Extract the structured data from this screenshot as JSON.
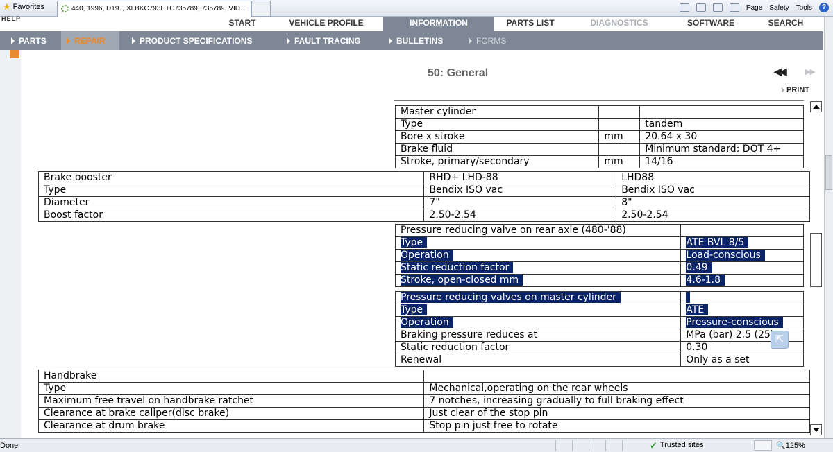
{
  "browser": {
    "favorites": "Favorites",
    "tab_title": "440, 1996, D19T, XLBKC793ETC735789, 735789, VID...",
    "tools": {
      "page": "Page",
      "safety": "Safety",
      "tools": "Tools"
    },
    "status_done": "Done",
    "trusted": "Trusted sites",
    "zoom": "125%"
  },
  "app": {
    "logo_fragment": "HELP",
    "nav_primary": [
      {
        "label": "START",
        "state": "normal"
      },
      {
        "label": "VEHICLE PROFILE",
        "state": "normal"
      },
      {
        "label": "INFORMATION",
        "state": "active"
      },
      {
        "label": "PARTS LIST",
        "state": "normal"
      },
      {
        "label": "DIAGNOSTICS",
        "state": "disabled"
      },
      {
        "label": "SOFTWARE",
        "state": "normal"
      },
      {
        "label": "SEARCH",
        "state": "normal"
      }
    ],
    "nav_secondary": [
      {
        "label": "PARTS",
        "state": "normal"
      },
      {
        "label": "REPAIR",
        "state": "active"
      },
      {
        "label": "PRODUCT SPECIFICATIONS",
        "state": "normal"
      },
      {
        "label": "FAULT TRACING",
        "state": "normal"
      },
      {
        "label": "BULLETINS",
        "state": "normal"
      },
      {
        "label": "FORMS",
        "state": "dim"
      }
    ],
    "accent": "#e88a2e",
    "nav_bg": "#7d8795",
    "highlight": "#0a246a"
  },
  "page": {
    "title": "50: General",
    "print": "PRINT",
    "nav_first": "◀◀",
    "nav_prev": "▶▶"
  },
  "master_cylinder": {
    "rows": [
      [
        "Master cylinder",
        "",
        ""
      ],
      [
        "Type",
        "",
        "tandem"
      ],
      [
        "Bore x stroke",
        "mm",
        "20.64 x 30"
      ],
      [
        "Brake fluid",
        "",
        "Minimum standard: DOT 4+"
      ],
      [
        "Stroke, primary/secondary",
        "mm",
        "14/16"
      ]
    ]
  },
  "brake_booster": {
    "rows": [
      [
        "Brake booster",
        "RHD+ LHD-88",
        "LHD88"
      ],
      [
        "Type",
        "Bendix ISO vac",
        "Bendix ISO vac"
      ],
      [
        "Diameter",
        "7\"",
        "8\""
      ],
      [
        "Boost factor",
        "2.50-2.54",
        "2.50-2.54"
      ]
    ]
  },
  "prv_rear_axle": {
    "rows": [
      [
        "Pressure reducing valve on rear axle (480-'88)",
        ""
      ],
      [
        "Type",
        "ATE BVL 8/5"
      ],
      [
        "Operation",
        "Load-conscious"
      ],
      [
        "Static reduction factor",
        "0.49"
      ],
      [
        "Stroke, open-closed mm",
        "4.6-1.8"
      ]
    ]
  },
  "prv_master_cylinder": {
    "rows": [
      [
        "Pressure reducing valves on master cylinder",
        ""
      ],
      [
        "Type",
        "ATE"
      ],
      [
        "Operation",
        "Pressure-conscious"
      ],
      [
        "Braking pressure reduces at",
        "MPa (bar) 2.5 (25)"
      ],
      [
        "Static reduction factor",
        "0.30"
      ],
      [
        "Renewal",
        "Only as a set"
      ]
    ]
  },
  "handbrake": {
    "rows": [
      [
        "Handbrake",
        ""
      ],
      [
        "Type",
        "Mechanical,operating on the rear wheels"
      ],
      [
        "Maximum free travel on handbrake ratchet",
        "7 notches, increasing gradually to full braking effect"
      ],
      [
        "Clearance at brake caliper(disc brake)",
        "Just clear of the stop pin"
      ],
      [
        "Clearance at drum brake",
        "Stop pin just free to rotate"
      ]
    ]
  }
}
